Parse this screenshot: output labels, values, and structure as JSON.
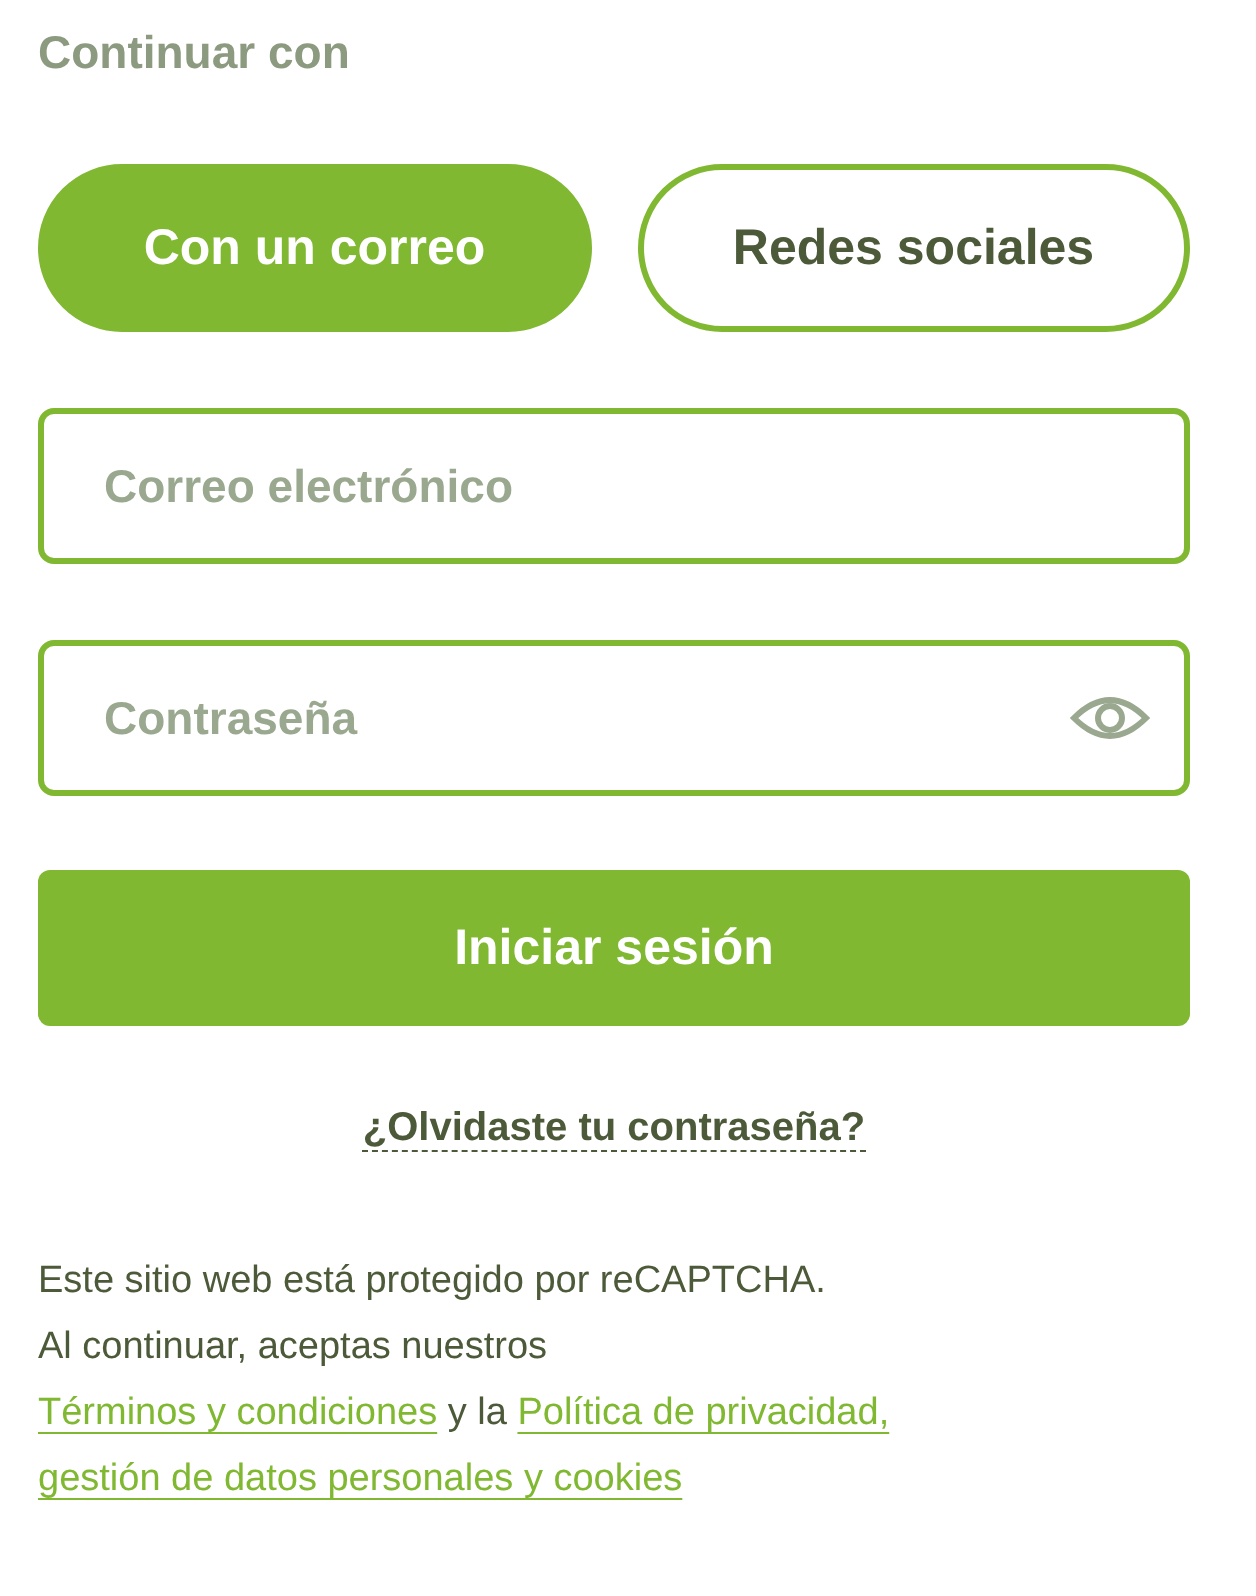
{
  "heading": "Continuar con",
  "tabs": [
    {
      "label": "Con un correo",
      "selected": true
    },
    {
      "label": "Redes sociales",
      "selected": false
    }
  ],
  "fields": [
    {
      "placeholder": "Correo electrónico",
      "kind": "text"
    },
    {
      "placeholder": "Contraseña",
      "kind": "password"
    }
  ],
  "submit": "Iniciar sesión",
  "forgot_link": "¿Olvidaste tu contraseña?",
  "notice": {
    "lines": [
      "Este sitio web está protegido por reCAPTCHA.",
      "Al continuar, aceptas nuestros"
    ],
    "terms_link": "Términos y condiciones",
    "connector": "y la",
    "privacy_link": "Política de privacidad,",
    "data_link": "gestión de datos personales y cookies"
  }
}
